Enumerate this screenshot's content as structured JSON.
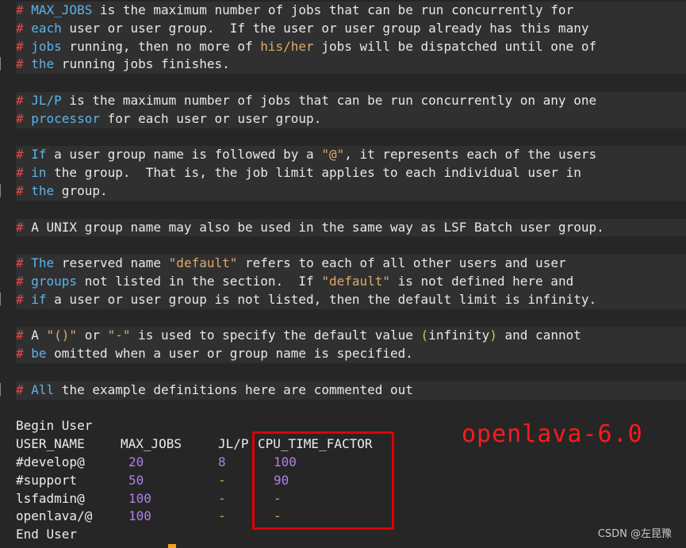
{
  "comments": [
    [
      [
        "hash",
        "# "
      ],
      [
        "kw",
        "MAX_JOBS"
      ],
      [
        "txt",
        " is the maximum number of jobs that can be run concurrently for"
      ]
    ],
    [
      [
        "hash",
        "# "
      ],
      [
        "kw",
        "each"
      ],
      [
        "txt",
        " user or user group.  If the user or user group already has this many"
      ]
    ],
    [
      [
        "hash",
        "# "
      ],
      [
        "kw",
        "jobs"
      ],
      [
        "txt",
        " running, then no more of "
      ],
      [
        "str",
        "his/her"
      ],
      [
        "txt",
        " jobs will be dispatched until one of"
      ]
    ],
    [
      [
        "hash",
        "# "
      ],
      [
        "kw",
        "the"
      ],
      [
        "txt",
        " running jobs finishes."
      ]
    ],
    [],
    [
      [
        "hash",
        "# "
      ],
      [
        "kw",
        "JL/P"
      ],
      [
        "txt",
        " is the maximum number of jobs that can be run concurrently on any one"
      ]
    ],
    [
      [
        "hash",
        "# "
      ],
      [
        "kw",
        "processor"
      ],
      [
        "txt",
        " for each user or user group."
      ]
    ],
    [],
    [
      [
        "hash",
        "# "
      ],
      [
        "kw",
        "If"
      ],
      [
        "txt",
        " a user group name is followed by a "
      ],
      [
        "str",
        "\"@\""
      ],
      [
        "txt",
        ", it represents each of the users"
      ]
    ],
    [
      [
        "hash",
        "# "
      ],
      [
        "kw",
        "in"
      ],
      [
        "txt",
        " the group.  That is, the job limit applies to each individual user in"
      ]
    ],
    [
      [
        "hash",
        "# "
      ],
      [
        "kw",
        "the"
      ],
      [
        "txt",
        " group."
      ]
    ],
    [],
    [
      [
        "hash",
        "# "
      ],
      [
        "txt",
        "A UNIX group name may also be used in the same way as LSF Batch user group."
      ]
    ],
    [],
    [
      [
        "hash",
        "# "
      ],
      [
        "kw",
        "The"
      ],
      [
        "txt",
        " reserved name "
      ],
      [
        "str",
        "\"default\""
      ],
      [
        "txt",
        " refers to each of all other users and user"
      ]
    ],
    [
      [
        "hash",
        "# "
      ],
      [
        "kw",
        "groups"
      ],
      [
        "txt",
        " not listed in the section.  If "
      ],
      [
        "str",
        "\"default\""
      ],
      [
        "txt",
        " is not defined here and"
      ]
    ],
    [
      [
        "hash",
        "# "
      ],
      [
        "kw",
        "if"
      ],
      [
        "txt",
        " a user or user group is not listed, then the default limit is infinity."
      ]
    ],
    [],
    [
      [
        "hash",
        "# "
      ],
      [
        "txt",
        "A "
      ],
      [
        "str",
        "\"()\""
      ],
      [
        "txt",
        " or "
      ],
      [
        "str",
        "\"-\""
      ],
      [
        "txt",
        " is used to specify the default value "
      ],
      [
        "paren",
        "("
      ],
      [
        "txt",
        "infinity"
      ],
      [
        "paren",
        ")"
      ],
      [
        "txt",
        " and cannot"
      ]
    ],
    [
      [
        "hash",
        "# "
      ],
      [
        "kw",
        "be"
      ],
      [
        "txt",
        " omitted when a user or group name is specified."
      ]
    ],
    [],
    [
      [
        "hash",
        "# "
      ],
      [
        "kw",
        "All"
      ],
      [
        "txt",
        " the example definitions here are commented out"
      ]
    ]
  ],
  "section": {
    "begin": "Begin User",
    "end": "End User",
    "headers": [
      "USER_NAME",
      "MAX_JOBS",
      "JL/P",
      "CPU_TIME_FACTOR"
    ],
    "rows": [
      [
        "#develop@",
        "20",
        "8",
        "100"
      ],
      [
        "#support",
        "50",
        "-",
        "90"
      ],
      [
        "lsfadmin@",
        "100",
        "-",
        "-"
      ],
      [
        "openlava/@",
        "100",
        "-",
        "-"
      ]
    ]
  },
  "annotation": "openlava-6.0",
  "watermark": "CSDN @左昆豫",
  "gutter_marks": [
    3,
    10,
    16,
    21
  ]
}
